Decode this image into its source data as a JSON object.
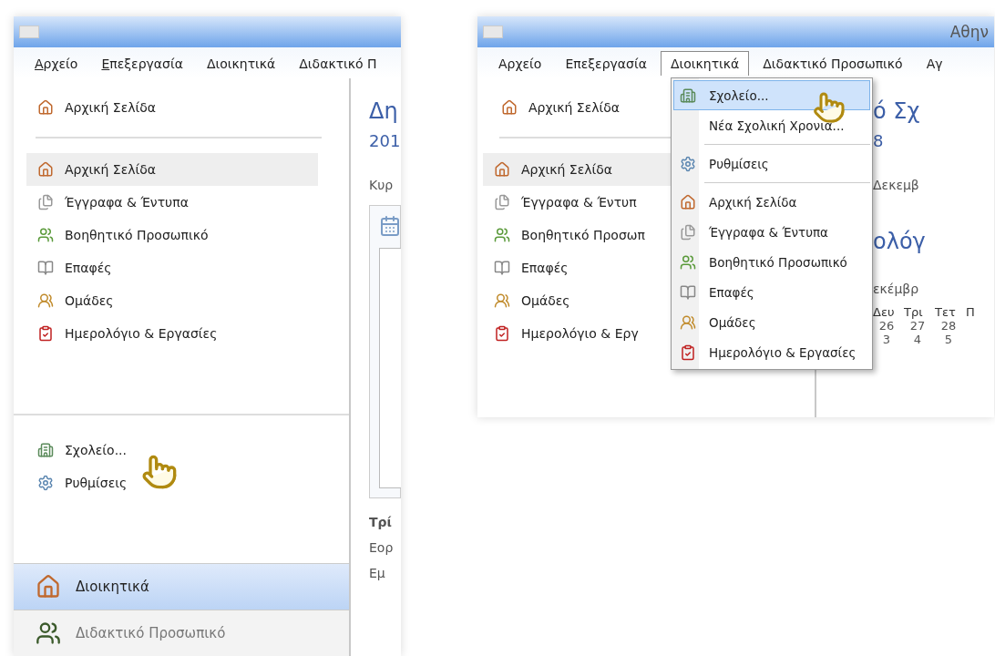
{
  "left_window": {
    "menu_bar": [
      {
        "label": "Αρχείο",
        "selected": false,
        "mnemonic": true
      },
      {
        "label": "Επεξεργασία",
        "selected": false,
        "mnemonic": true
      },
      {
        "label": "Διοικητικά",
        "selected": false,
        "mnemonic": false
      },
      {
        "label": "Διδακτικό Π",
        "selected": false,
        "mnemonic": false
      }
    ],
    "sidebar": {
      "home": "Αρχική Σελίδα",
      "items": [
        {
          "label": "Αρχική Σελίδα",
          "selected": true
        },
        {
          "label": "Έγγραφα & Έντυπα",
          "selected": false
        },
        {
          "label": "Βοηθητικό Προσωπικό",
          "selected": false
        },
        {
          "label": "Επαφές",
          "selected": false
        },
        {
          "label": "Ομάδες",
          "selected": false
        },
        {
          "label": "Ημερολόγιο & Εργασίες",
          "selected": false
        }
      ],
      "actions": [
        "Σχολείο...",
        "Ρυθμίσεις"
      ],
      "sections": [
        {
          "label": "Διοικητικά",
          "selected": true
        },
        {
          "label": "Διδακτικό Προσωπικό",
          "selected": false
        }
      ]
    },
    "content": {
      "title": "Δη",
      "subtitle": "201",
      "tab": "Κυρ",
      "rows": [
        "Τρί",
        "Εορ",
        "Εμ"
      ]
    }
  },
  "right_window": {
    "title": "Αθην",
    "menu_bar": [
      {
        "label": "Αρχείο",
        "selected": false
      },
      {
        "label": "Επεξεργασία",
        "selected": false
      },
      {
        "label": "Διοικητικά",
        "selected": true
      },
      {
        "label": "Διδακτικό Προσωπικό",
        "selected": false
      },
      {
        "label": "Αγ",
        "selected": false
      }
    ],
    "sidebar": {
      "home": "Αρχική Σελίδα",
      "items": [
        {
          "label": "Αρχική Σελίδα",
          "selected": true
        },
        {
          "label": "Έγγραφα & Έντυπ",
          "selected": false
        },
        {
          "label": "Βοηθητικό Προσωπ",
          "selected": false
        },
        {
          "label": "Επαφές",
          "selected": false
        },
        {
          "label": "Ομάδες",
          "selected": false
        },
        {
          "label": "Ημερολόγιο & Εργ",
          "selected": false
        }
      ]
    },
    "dropdown": [
      [
        {
          "label": "Σχολείο...",
          "selected": true
        },
        {
          "label": "Νέα Σχολική Χρονιά...",
          "selected": false
        }
      ],
      [
        {
          "label": "Ρυθμίσεις",
          "selected": false
        }
      ],
      [
        {
          "label": "Αρχική Σελίδα",
          "selected": false
        },
        {
          "label": "Έγγραφα & Έντυπα",
          "selected": false
        },
        {
          "label": "Βοηθητικό Προσωπικό",
          "selected": false
        },
        {
          "label": "Επαφές",
          "selected": false
        },
        {
          "label": "Ομάδες",
          "selected": false
        },
        {
          "label": "Ημερολόγιο & Εργασίες",
          "selected": false
        }
      ]
    ],
    "content": {
      "title": "ό Σχ",
      "subtitle": "8",
      "date": "Δεκεμβ",
      "panel_title": "ολόγ",
      "month": "εκέμβρ",
      "weekdays": [
        "Δευ",
        "Τρι",
        "Τετ",
        "Π"
      ],
      "weeks": [
        [
          "26",
          "27",
          "28"
        ],
        [
          "3",
          "4",
          "5"
        ]
      ]
    }
  }
}
